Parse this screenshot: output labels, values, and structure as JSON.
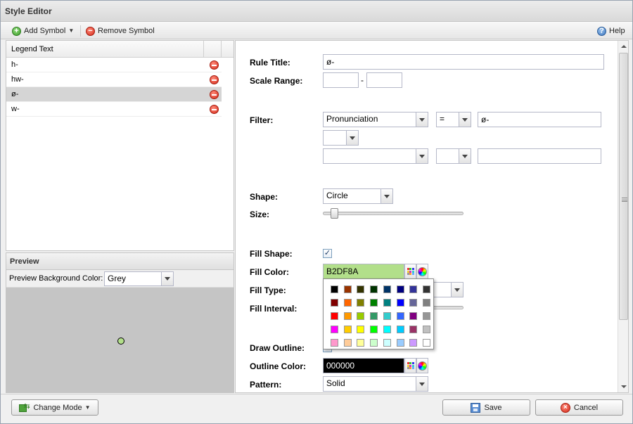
{
  "window": {
    "title": "Style Editor"
  },
  "toolbar": {
    "add_symbol": "Add Symbol",
    "remove_symbol": "Remove Symbol",
    "help": "Help"
  },
  "legend": {
    "header": "Legend Text",
    "rows": [
      {
        "text": "h-"
      },
      {
        "text": "hw-"
      },
      {
        "text": "ø-",
        "selected": true
      },
      {
        "text": "w-"
      }
    ]
  },
  "preview": {
    "title": "Preview",
    "bg_label": "Preview Background Color:",
    "bg_value": "Grey",
    "point_color": "#b2df8a"
  },
  "form": {
    "rule_title_label": "Rule Title:",
    "rule_title_value": "ø-",
    "scale_range_label": "Scale Range:",
    "scale_range_sep": "-",
    "filter_label": "Filter:",
    "filter_field": "Pronunciation",
    "filter_op": "=",
    "filter_value": "ø-",
    "shape_label": "Shape:",
    "shape_value": "Circle",
    "size_label": "Size:",
    "fill_shape_label": "Fill Shape:",
    "fill_shape_checked": "✓",
    "fill_color_label": "Fill Color:",
    "fill_color_value": "B2DF8A",
    "fill_type_label": "Fill Type:",
    "fill_interval_label": "Fill Interval:",
    "draw_outline_label": "Draw Outline:",
    "outline_color_label": "Outline Color:",
    "outline_color_value": "000000",
    "pattern_label": "Pattern:",
    "pattern_value": "Solid"
  },
  "palette": [
    [
      "#000000",
      "#993300",
      "#333300",
      "#003300",
      "#003366",
      "#000080",
      "#333399",
      "#333333"
    ],
    [
      "#800000",
      "#FF6600",
      "#808000",
      "#008000",
      "#008080",
      "#0000FF",
      "#666699",
      "#808080"
    ],
    [
      "#FF0000",
      "#FF9900",
      "#99CC00",
      "#339966",
      "#33CCCC",
      "#3366FF",
      "#800080",
      "#969696"
    ],
    [
      "#FF00FF",
      "#FFCC00",
      "#FFFF00",
      "#00FF00",
      "#00FFFF",
      "#00CCFF",
      "#993366",
      "#C0C0C0"
    ],
    [
      "#FF99CC",
      "#FFCC99",
      "#FFFF99",
      "#CCFFCC",
      "#CCFFFF",
      "#99CCFF",
      "#CC99FF",
      "#FFFFFF"
    ]
  ],
  "footer": {
    "change_mode": "Change Mode",
    "save": "Save",
    "cancel": "Cancel"
  }
}
